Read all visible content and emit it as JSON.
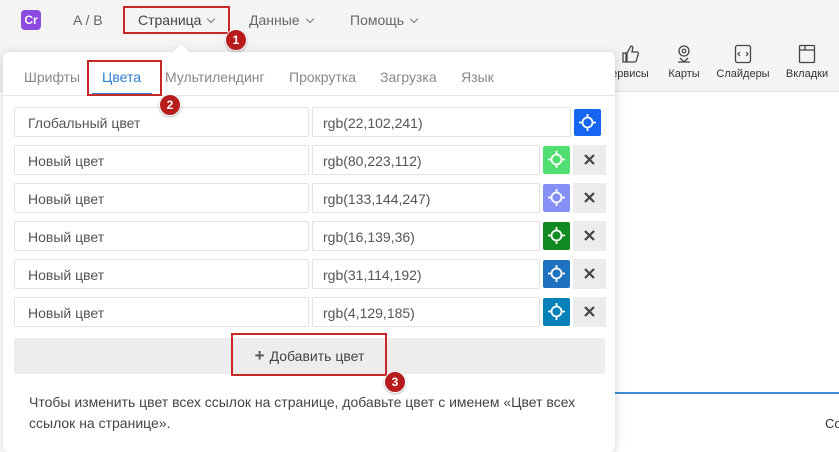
{
  "topbar": {
    "logo": "Cr",
    "ab_label": "A / B",
    "menus": [
      "Страница",
      "Данные",
      "Помощь"
    ]
  },
  "toolbar": {
    "items": [
      "ервисы",
      "Карты",
      "Слайдеры",
      "Вкладки"
    ]
  },
  "panel": {
    "tabs": [
      "Шрифты",
      "Цвета",
      "Мультилендинг",
      "Прокрутка",
      "Загрузка",
      "Язык"
    ],
    "active_tab": "Цвета",
    "global_color": {
      "name": "Глобальный цвет",
      "value": "rgb(22,102,241)",
      "swatch": "#1666f1"
    },
    "colors": [
      {
        "name": "Новый цвет",
        "value": "rgb(80,223,112)",
        "swatch": "#50df70"
      },
      {
        "name": "Новый цвет",
        "value": "rgb(133,144,247)",
        "swatch": "#8590f7"
      },
      {
        "name": "Новый цвет",
        "value": "rgb(16,139,36)",
        "swatch": "#108b24"
      },
      {
        "name": "Новый цвет",
        "value": "rgb(31,114,192)",
        "swatch": "#1f72c0"
      },
      {
        "name": "Новый цвет",
        "value": "rgb(4,129,185)",
        "swatch": "#0481b9"
      }
    ],
    "add_button": "Добавить цвет",
    "hint": "Чтобы изменить цвет всех ссылок на странице, добавьте цвет с именем «Цвет всех ссылок на странице»."
  },
  "annotations": [
    "1",
    "2",
    "3"
  ],
  "edge_text": "Со",
  "colors": {
    "accent": "#2f7fd0",
    "annotation": "#c62828",
    "logo": "#8b4be0"
  }
}
